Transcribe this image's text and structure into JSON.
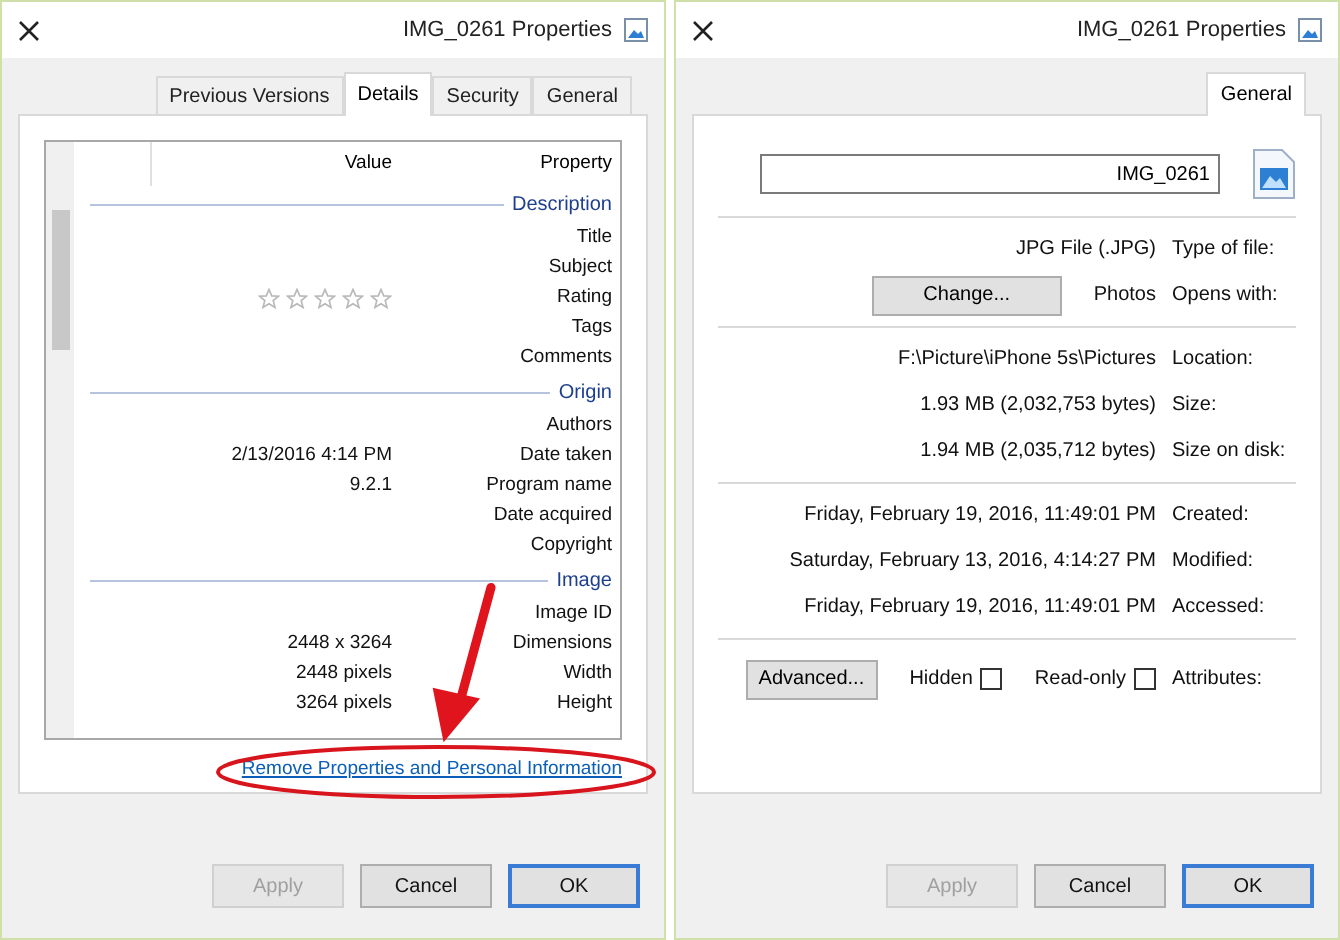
{
  "details_dialog": {
    "title": "IMG_0261 Properties",
    "tabs": [
      {
        "label": "Previous Versions",
        "selected": false
      },
      {
        "label": "Details",
        "selected": true
      },
      {
        "label": "Security",
        "selected": false
      },
      {
        "label": "General",
        "selected": false
      }
    ],
    "columns": [
      "Value",
      "Property"
    ],
    "groups": [
      {
        "name": "Description",
        "rows": [
          {
            "kind": "text",
            "property": "Title"
          },
          {
            "kind": "text",
            "property": "Subject"
          },
          {
            "kind": "stars",
            "property": "Rating",
            "stars": 0
          },
          {
            "kind": "text",
            "property": "Tags"
          },
          {
            "kind": "text",
            "property": "Comments"
          }
        ]
      },
      {
        "name": "Origin",
        "rows": [
          {
            "kind": "text",
            "property": "Authors"
          },
          {
            "kind": "text",
            "property": "Date taken",
            "value": "2/13/2016 4:14 PM"
          },
          {
            "kind": "text",
            "property": "Program name",
            "value": "9.2.1"
          },
          {
            "kind": "text",
            "property": "Date acquired"
          },
          {
            "kind": "text",
            "property": "Copyright"
          }
        ]
      },
      {
        "name": "Image",
        "rows": [
          {
            "kind": "text",
            "property": "Image ID"
          },
          {
            "kind": "text",
            "property": "Dimensions",
            "value": "2448 x 3264"
          },
          {
            "kind": "text",
            "property": "Width",
            "value": "2448 pixels"
          },
          {
            "kind": "text",
            "property": "Height",
            "value": "3264 pixels"
          }
        ]
      }
    ],
    "link": "Remove Properties and Personal Information",
    "buttons": [
      {
        "label": "Apply",
        "disabled": true
      },
      {
        "label": "Cancel",
        "disabled": false
      },
      {
        "label": "OK",
        "disabled": false
      }
    ]
  },
  "general_dialog": {
    "title": "IMG_0261 Properties",
    "tabs": [
      {
        "label": "General",
        "selected": true
      }
    ],
    "file_name": "IMG_0261",
    "sections": [
      [
        {
          "label": "Type of file:",
          "value": "JPG File (.JPG)"
        },
        {
          "label": "Opens with:",
          "value": "Photos",
          "button": "Change..."
        }
      ],
      [
        {
          "label": "Location:",
          "value": "F:\\Picture\\iPhone 5s\\Pictures"
        },
        {
          "label": "Size:",
          "value": "1.93 MB (2,032,753 bytes)"
        },
        {
          "label": "Size on disk:",
          "value": "1.94 MB (2,035,712 bytes)"
        }
      ],
      [
        {
          "label": "Created:",
          "value": "Friday, February 19, 2016, 11:49:01 PM"
        },
        {
          "label": "Modified:",
          "value": "Saturday, February 13, 2016, 4:14:27 PM"
        },
        {
          "label": "Accessed:",
          "value": "Friday, February 19, 2016, 11:49:01 PM"
        }
      ]
    ],
    "attributes": {
      "label": "Attributes:",
      "checkboxes": [
        {
          "label": "Hidden",
          "checked": false
        },
        {
          "label": "Read-only",
          "checked": false
        }
      ],
      "button": "Advanced..."
    },
    "buttons": [
      {
        "label": "Apply",
        "disabled": true
      },
      {
        "label": "Cancel",
        "disabled": false
      },
      {
        "label": "OK",
        "disabled": false
      }
    ]
  }
}
